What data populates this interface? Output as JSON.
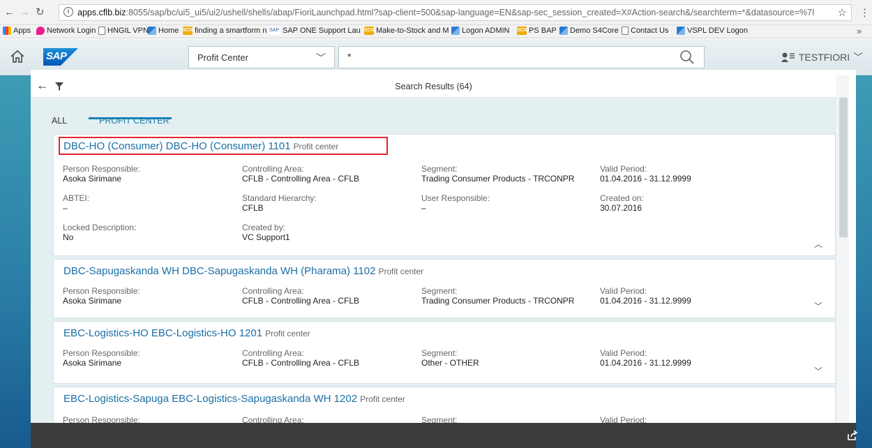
{
  "browser": {
    "url_host": "apps.cflb.biz",
    "url_rest": ":8055/sap/bc/ui5_ui5/ui2/ushell/shells/abap/FioriLaunchpad.html?sap-client=500&sap-language=EN&sap-sec_session_created=X#Action-search&/searchterm=*&datasource=%7I",
    "bookmarks": [
      "Apps",
      "Network Login",
      "HNGIL VPN",
      "Home",
      "finding a smartform n",
      "SAP ONE Support Lau",
      "Make-to-Stock and M",
      "Logon ADMIN",
      "PS BAP",
      "Demo S4Core",
      "Contact Us",
      "VSPL DEV Logon"
    ],
    "bookmark_more": "»"
  },
  "shell": {
    "logo": "SAP",
    "scope_label": "Profit Center",
    "search_term": "*",
    "user": "TESTFIORI"
  },
  "search": {
    "results_label": "Search Results (64)",
    "tabs": [
      "ALL",
      "PROFIT CENTER"
    ],
    "active_tab": "PROFIT CENTER"
  },
  "cards": [
    {
      "title": "DBC-HO (Consumer) DBC-HO (Consumer) 1101",
      "kind": "Profit center",
      "expanded": true,
      "highlighted": true,
      "fields": [
        {
          "label": "Person Responsible:",
          "value": "Asoka Sirimane"
        },
        {
          "label": "Controlling Area:",
          "value": "CFLB - Controlling Area - CFLB"
        },
        {
          "label": "Segment:",
          "value": "Trading Consumer Products - TRCONPR"
        },
        {
          "label": "Valid Period:",
          "value": "01.04.2016 - 31.12.9999"
        },
        {
          "label": "ABTEI:",
          "value": "–"
        },
        {
          "label": "Standard Hierarchy:",
          "value": "CFLB"
        },
        {
          "label": "User Responsible:",
          "value": "–"
        },
        {
          "label": "Created on:",
          "value": "30.07.2016"
        },
        {
          "label": "Locked Description:",
          "value": "No"
        },
        {
          "label": "Created by:",
          "value": "VC Support1"
        }
      ]
    },
    {
      "title": "DBC-Sapugaskanda WH DBC-Sapugaskanda WH (Pharama) 1102",
      "kind": "Profit center",
      "expanded": false,
      "fields": [
        {
          "label": "Person Responsible:",
          "value": "Asoka Sirimane"
        },
        {
          "label": "Controlling Area:",
          "value": "CFLB - Controlling Area - CFLB"
        },
        {
          "label": "Segment:",
          "value": "Trading Consumer Products - TRCONPR"
        },
        {
          "label": "Valid Period:",
          "value": "01.04.2016 - 31.12.9999"
        }
      ]
    },
    {
      "title": "EBC-Logistics-HO EBC-Logistics-HO 1201",
      "kind": "Profit center",
      "expanded": false,
      "fields": [
        {
          "label": "Person Responsible:",
          "value": "Asoka Sirimane"
        },
        {
          "label": "Controlling Area:",
          "value": "CFLB - Controlling Area - CFLB"
        },
        {
          "label": "Segment:",
          "value": "Other - OTHER"
        },
        {
          "label": "Valid Period:",
          "value": "01.04.2016 - 31.12.9999"
        }
      ]
    },
    {
      "title": "EBC-Logistics-Sapuga EBC-Logistics-Sapugaskanda WH 1202",
      "kind": "Profit center",
      "expanded": false,
      "fields": [
        {
          "label": "Person Responsible:",
          "value": ""
        },
        {
          "label": "Controlling Area:",
          "value": ""
        },
        {
          "label": "Segment:",
          "value": ""
        },
        {
          "label": "Valid Period:",
          "value": ""
        }
      ]
    }
  ],
  "colors": {
    "link": "#1a6fa5",
    "accent": "#1a7fb3",
    "highlight": "#e3252e",
    "footer": "#3b3b3b"
  }
}
